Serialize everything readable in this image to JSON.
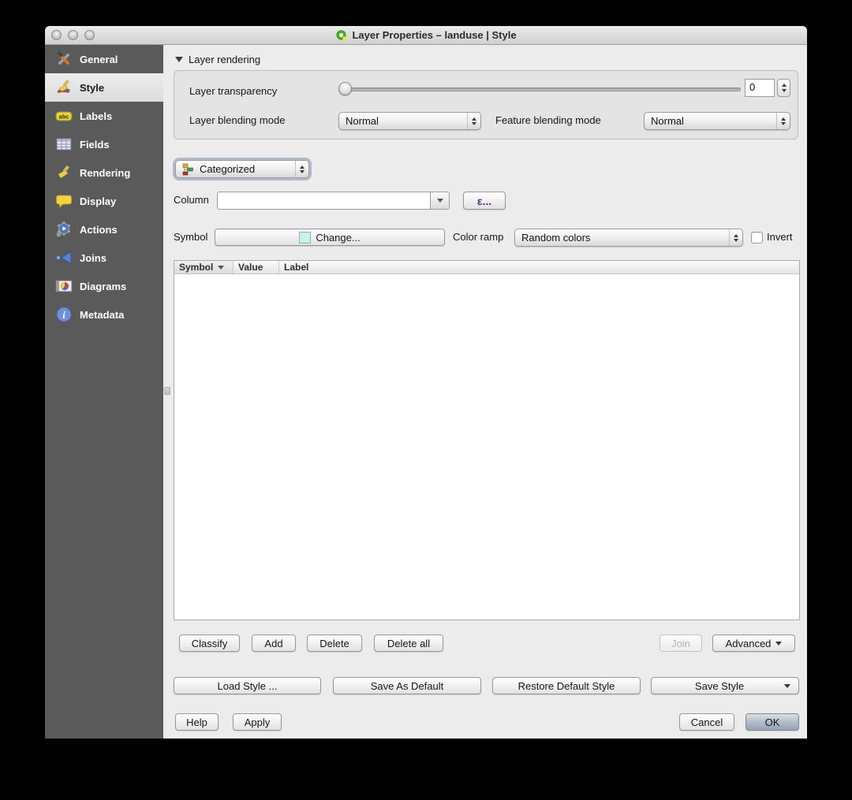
{
  "window": {
    "title": "Layer Properties – landuse | Style",
    "app_icon": "qgis-icon"
  },
  "sidebar": {
    "items": [
      {
        "label": "General",
        "icon": "tools-icon",
        "selected": false
      },
      {
        "label": "Style",
        "icon": "style-brush-icon",
        "selected": true
      },
      {
        "label": "Labels",
        "icon": "abc-badge-icon",
        "selected": false
      },
      {
        "label": "Fields",
        "icon": "table-grid-icon",
        "selected": false
      },
      {
        "label": "Rendering",
        "icon": "brush-icon",
        "selected": false
      },
      {
        "label": "Display",
        "icon": "speech-bubble-icon",
        "selected": false
      },
      {
        "label": "Actions",
        "icon": "gear-action-icon",
        "selected": false
      },
      {
        "label": "Joins",
        "icon": "join-arrow-icon",
        "selected": false
      },
      {
        "label": "Diagrams",
        "icon": "diagram-icon",
        "selected": false
      },
      {
        "label": "Metadata",
        "icon": "info-icon",
        "selected": false
      }
    ]
  },
  "layer_rendering": {
    "header": "Layer rendering",
    "transparency_label": "Layer transparency",
    "transparency_value": "0",
    "transparency_slider_percent": 0,
    "layer_blending_label": "Layer blending mode",
    "layer_blending_value": "Normal",
    "feature_blending_label": "Feature blending mode",
    "feature_blending_value": "Normal"
  },
  "renderer": {
    "type_value": "Categorized",
    "column_label": "Column",
    "column_value": "",
    "expression_button": "ε...",
    "symbol_label": "Symbol",
    "change_button": "Change...",
    "color_ramp_label": "Color ramp",
    "color_ramp_value": "Random colors",
    "invert_label": "Invert",
    "invert_checked": false,
    "symbol_swatch_color": "#c9f2ee"
  },
  "table": {
    "columns": [
      "Symbol",
      "Value",
      "Label"
    ],
    "rows": []
  },
  "actions": {
    "classify": "Classify",
    "add": "Add",
    "delete": "Delete",
    "delete_all": "Delete all",
    "join": "Join",
    "advanced": "Advanced"
  },
  "style_buttons": {
    "load": "Load Style ...",
    "save_default": "Save As Default",
    "restore_default": "Restore Default Style",
    "save_style": "Save Style"
  },
  "dialog_buttons": {
    "help": "Help",
    "apply": "Apply",
    "cancel": "Cancel",
    "ok": "OK"
  },
  "colors": {
    "sidebar_bg": "#5a5a5a",
    "selected_item_bg": "#e4e4e4",
    "panel_bg": "#ececec",
    "epsilon_purple": "#5f2a7e",
    "ok_button_gradient_top": "#d9dee6",
    "ok_button_gradient_bottom": "#97a2b4",
    "symbol_swatch": "#c9f2ee"
  }
}
